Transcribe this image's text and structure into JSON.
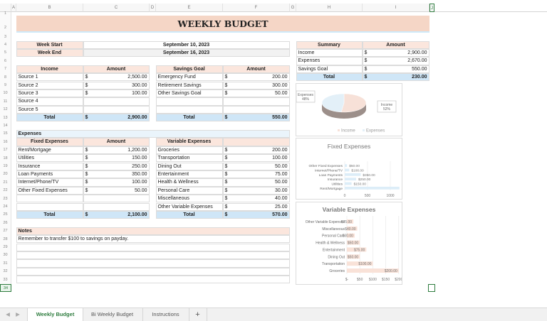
{
  "columns": [
    "A",
    "B",
    "C",
    "D",
    "E",
    "F",
    "G",
    "H",
    "I",
    "J"
  ],
  "rows": [
    "1",
    "2",
    "3",
    "4",
    "5",
    "6",
    "7",
    "8",
    "9",
    "10",
    "11",
    "12",
    "13",
    "14",
    "15",
    "16",
    "17",
    "18",
    "19",
    "20",
    "21",
    "22",
    "23",
    "24",
    "25",
    "26",
    "27",
    "28",
    "29",
    "30",
    "31",
    "32",
    "33",
    "34"
  ],
  "currency": "$",
  "title": "WEEKLY BUDGET",
  "week": {
    "start_label": "Week Start",
    "start": "September 10, 2023",
    "end_label": "Week End",
    "end": "September 16, 2023"
  },
  "income": {
    "header": [
      "Income",
      "Amount"
    ],
    "rows": [
      {
        "label": "Source 1",
        "amount": "2,500.00"
      },
      {
        "label": "Source 2",
        "amount": "300.00"
      },
      {
        "label": "Source 3",
        "amount": "100.00"
      },
      {
        "label": "Source 4",
        "amount": ""
      },
      {
        "label": "Source 5",
        "amount": ""
      }
    ],
    "total_label": "Total",
    "total": "2,900.00"
  },
  "savings": {
    "header": [
      "Savings Goal",
      "Amount"
    ],
    "rows": [
      {
        "label": "Emergency Fund",
        "amount": "200.00"
      },
      {
        "label": "Retirement Savings",
        "amount": "300.00"
      },
      {
        "label": "Other Savings Goal",
        "amount": "50.00"
      },
      {
        "label": "",
        "amount": ""
      },
      {
        "label": "",
        "amount": ""
      }
    ],
    "total_label": "Total",
    "total": "550.00"
  },
  "summary": {
    "header": [
      "Summary",
      "Amount"
    ],
    "rows": [
      {
        "label": "Income",
        "amount": "2,900.00"
      },
      {
        "label": "Expenses",
        "amount": "2,670.00"
      },
      {
        "label": "Savings Goal",
        "amount": "550.00"
      }
    ],
    "total_label": "Total",
    "total": "230.00"
  },
  "expenses_label": "Expenses",
  "fixed": {
    "header": [
      "Fixed Expenses",
      "Amount"
    ],
    "rows": [
      {
        "label": "Rent/Mortgage",
        "amount": "1,200.00"
      },
      {
        "label": "Utilities",
        "amount": "150.00"
      },
      {
        "label": "Insurance",
        "amount": "250.00"
      },
      {
        "label": "Loan Payments",
        "amount": "350.00"
      },
      {
        "label": "Internet/Phone/TV",
        "amount": "100.00"
      },
      {
        "label": "Other Fixed Expenses",
        "amount": "50.00"
      },
      {
        "label": "",
        "amount": ""
      },
      {
        "label": "",
        "amount": ""
      }
    ],
    "total_label": "Total",
    "total": "2,100.00"
  },
  "variable": {
    "header": [
      "Variable Expenses",
      ""
    ],
    "rows": [
      {
        "label": "Groceries",
        "amount": "200.00"
      },
      {
        "label": "Transportation",
        "amount": "100.00"
      },
      {
        "label": "Dining Out",
        "amount": "50.00"
      },
      {
        "label": "Entertainment",
        "amount": "75.00"
      },
      {
        "label": "Health & Wellness",
        "amount": "50.00"
      },
      {
        "label": "Personal Care",
        "amount": "30.00"
      },
      {
        "label": "Miscellaneous",
        "amount": "40.00"
      },
      {
        "label": "Other Variable Expenses",
        "amount": "25.00"
      }
    ],
    "total_label": "Total",
    "total": "570.00"
  },
  "notes": {
    "label": "Notes",
    "lines": [
      "Remember to transfer $100 to savings on payday.",
      "",
      "",
      "",
      "",
      ""
    ]
  },
  "sheet_tabs": [
    "Weekly Budget",
    "Bi Weekly Budget",
    "Instructions"
  ],
  "add_sheet": "+",
  "colors": {
    "accent": "#2f7d3f",
    "header_pink": "#fbe6dd",
    "total_blue": "#cfe6f7",
    "title_band": "#f5d6c6"
  },
  "chart_data": [
    {
      "type": "pie",
      "title": "",
      "categories": [
        "Income",
        "Expenses"
      ],
      "values": [
        52,
        48
      ],
      "data_labels": [
        [
          "Income",
          "52%"
        ],
        [
          "Expenses",
          "48%"
        ]
      ],
      "legend": [
        "Income",
        "Expenses"
      ],
      "legend_position": "bottom",
      "colors": [
        "#f7e1d8",
        "#e3f0f8"
      ]
    },
    {
      "type": "bar",
      "orientation": "horizontal",
      "title": "Fixed Expenses",
      "categories": [
        "Other Fixed Expenses",
        "Internet/Phone/TV",
        "Loan Payments",
        "Insurance",
        "Utilities",
        "Rent/Mortgage"
      ],
      "values": [
        50,
        100,
        350,
        250,
        150,
        1200
      ],
      "data_labels": [
        "$50.00",
        "$100.00",
        "$350.00",
        "$250.00",
        "$150.00",
        "$1,200.00"
      ],
      "xticks": [
        "0",
        "500",
        "1000",
        "1500"
      ],
      "xlim": [
        0,
        1500
      ],
      "grid": true,
      "color": "#dcedf8"
    },
    {
      "type": "bar",
      "orientation": "horizontal",
      "title": "Variable Expenses",
      "categories": [
        "Other Variable Expenses",
        "Miscellaneous",
        "Personal Care",
        "Health & Wellness",
        "Entertainment",
        "Dining Out",
        "Transportation",
        "Groceries"
      ],
      "values": [
        25,
        40,
        30,
        50,
        75,
        50,
        100,
        200
      ],
      "data_labels": [
        "$25.00",
        "$40.00",
        "$30.00",
        "$50.00",
        "$75.00",
        "$50.00",
        "$100.00",
        "$200.00"
      ],
      "xticks": [
        "$-",
        "$50",
        "$100",
        "$150",
        "$200",
        "$250"
      ],
      "xlim": [
        0,
        250
      ],
      "grid": true,
      "color": "#f9e2d8"
    }
  ]
}
